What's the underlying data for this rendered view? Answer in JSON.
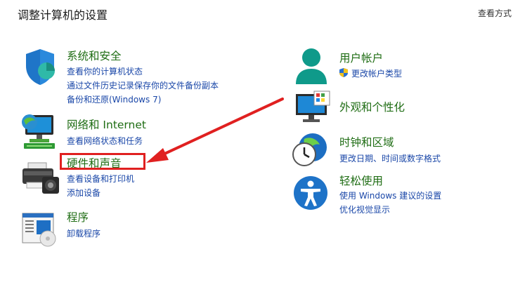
{
  "header": {
    "title": "调整计算机的设置",
    "view_by": "查看方式"
  },
  "left": {
    "system_security": {
      "title": "系统和安全",
      "links": [
        "查看你的计算机状态",
        "通过文件历史记录保存你的文件备份副本",
        "备份和还原(Windows 7)"
      ]
    },
    "network": {
      "title": "网络和 Internet",
      "links": [
        "查看网络状态和任务"
      ]
    },
    "hardware": {
      "title": "硬件和声音",
      "links": [
        "查看设备和打印机",
        "添加设备"
      ]
    },
    "programs": {
      "title": "程序",
      "links": [
        "卸载程序"
      ]
    }
  },
  "right": {
    "user_accounts": {
      "title": "用户帐户",
      "links": [
        "更改帐户类型"
      ]
    },
    "appearance": {
      "title": "外观和个性化"
    },
    "clock_region": {
      "title": "时钟和区域",
      "links": [
        "更改日期、时间或数字格式"
      ]
    },
    "ease_of_access": {
      "title": "轻松使用",
      "links": [
        "使用 Windows 建议的设置",
        "优化视觉显示"
      ]
    }
  },
  "colors": {
    "category_title": "#1f6d14",
    "link": "#1a47a8",
    "annotation_red": "#e02020"
  }
}
